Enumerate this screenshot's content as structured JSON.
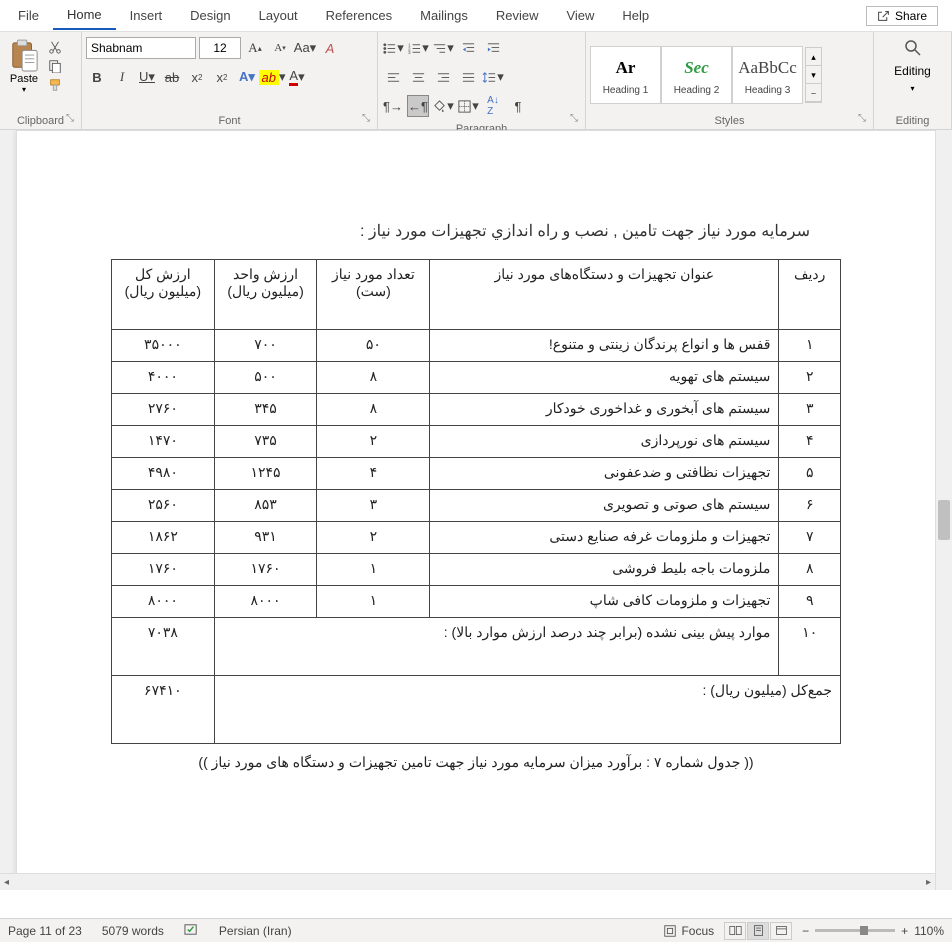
{
  "tabs": {
    "file": "File",
    "home": "Home",
    "insert": "Insert",
    "design": "Design",
    "layout": "Layout",
    "references": "References",
    "mailings": "Mailings",
    "review": "Review",
    "view": "View",
    "help": "Help"
  },
  "share": "Share",
  "ribbon": {
    "clipboard": {
      "label": "Clipboard",
      "paste": "Paste"
    },
    "font": {
      "label": "Font",
      "name": "Shabnam",
      "size": "12"
    },
    "paragraph": {
      "label": "Paragraph"
    },
    "styles": {
      "label": "Styles",
      "h1_preview": "Ar",
      "h1": "Heading 1",
      "h2_preview": "Sec",
      "h2": "Heading 2",
      "h3_preview": "AaBbCc",
      "h3": "Heading 3"
    },
    "editing": {
      "label": "Editing",
      "button": "Editing"
    }
  },
  "doc": {
    "title": "سرمایه مورد نیاز جهت تامین , نصب و راه اندازي تجهیزات مورد نیاز :",
    "headers": {
      "row": "ردیف",
      "desc": "عنوان تجهیزات و دستگاه‌های مورد نیاز",
      "qty": "تعداد مورد نیاز (ست)",
      "unit": "ارزش واحد (میلیون ریال)",
      "total": "ارزش کل (میلیون ریال)"
    },
    "rows": [
      {
        "n": "۱",
        "desc": "قفس ها و انواع پرندگان زینتی و متنوع!",
        "qty": "۵۰",
        "unit": "۷۰۰",
        "total": "۳۵۰۰۰"
      },
      {
        "n": "۲",
        "desc": "سیستم های تهویه",
        "qty": "۸",
        "unit": "۵۰۰",
        "total": "۴۰۰۰"
      },
      {
        "n": "۳",
        "desc": "سیستم های آبخوری و غداخوری خودکار",
        "qty": "۸",
        "unit": "۳۴۵",
        "total": "۲۷۶۰"
      },
      {
        "n": "۴",
        "desc": "سیستم های نورپردازی",
        "qty": "۲",
        "unit": "۷۳۵",
        "total": "۱۴۷۰"
      },
      {
        "n": "۵",
        "desc": "تجهیزات نظافتی و ضدعفونی",
        "qty": "۴",
        "unit": "۱۲۴۵",
        "total": "۴۹۸۰"
      },
      {
        "n": "۶",
        "desc": "سیستم های صوتی و تصویری",
        "qty": "۳",
        "unit": "۸۵۳",
        "total": "۲۵۶۰"
      },
      {
        "n": "۷",
        "desc": "تجهیزات و ملزومات غرفه صنایع دستی",
        "qty": "۲",
        "unit": "۹۳۱",
        "total": "۱۸۶۲"
      },
      {
        "n": "۸",
        "desc": "ملزومات باجه بلیط فروشی",
        "qty": "۱",
        "unit": "۱۷۶۰",
        "total": "۱۷۶۰"
      },
      {
        "n": "۹",
        "desc": "تجهیزات و ملزومات کافی شاپ",
        "qty": "۱",
        "unit": "۸۰۰۰",
        "total": "۸۰۰۰"
      }
    ],
    "misc": {
      "n": "۱۰",
      "desc": "موارد پیش بینی نشده (برابر چند درصد ارزش موارد بالا) :",
      "total": "۷۰۳۸"
    },
    "grand": {
      "label": "جمع‌کل (میلیون ریال) :",
      "value": "۶۷۴۱۰"
    },
    "caption": "(( جدول شماره ۷ : برآورد میزان سرمایه مورد نیاز جهت تامین تجهیزات و دستگاه های مورد نیاز ))"
  },
  "status": {
    "page": "Page 11 of 23",
    "words": "5079 words",
    "lang": "Persian (Iran)",
    "focus": "Focus",
    "zoom": "110%"
  }
}
